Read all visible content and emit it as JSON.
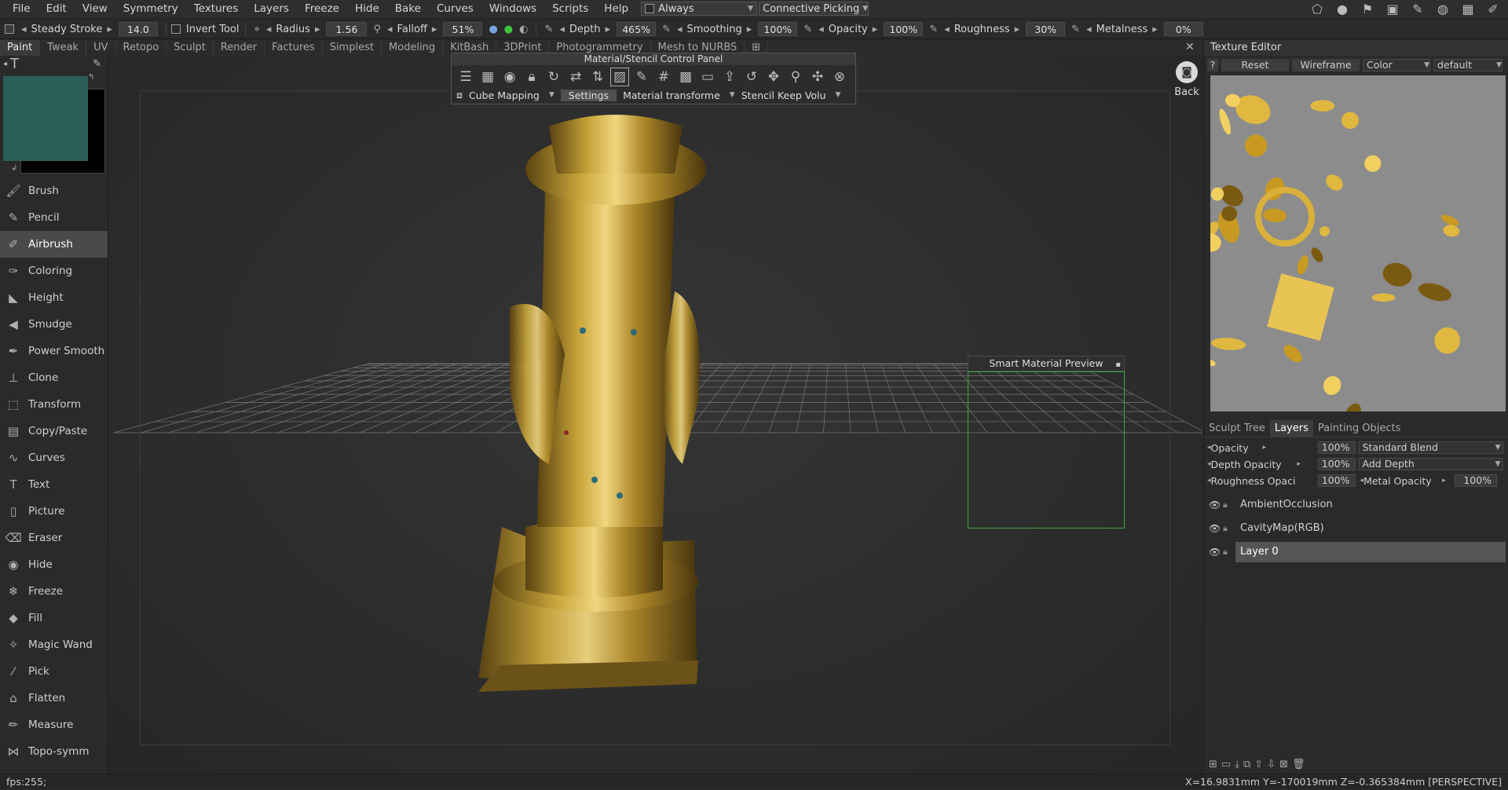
{
  "menu": [
    "File",
    "Edit",
    "View",
    "Symmetry",
    "Textures",
    "Layers",
    "Freeze",
    "Hide",
    "Bake",
    "Curves",
    "Windows",
    "Scripts",
    "Help"
  ],
  "menu_extra": {
    "always_label": "Always",
    "picking_label": "Connective  Picking"
  },
  "toolbar": {
    "steady_stroke_label": "Steady  Stroke",
    "steady_stroke_value": "14.0",
    "invert_tool_label": "Invert  Tool",
    "radius_label": "Radius",
    "radius_value": "1.56",
    "falloff_label": "Falloff",
    "falloff_value": "51%",
    "depth_label": "Depth",
    "depth_value": "465%",
    "smoothing_label": "Smoothing",
    "smoothing_value": "100%",
    "opacity_label": "Opacity",
    "opacity_value": "100%",
    "roughness_label": "Roughness",
    "roughness_value": "30%",
    "metalness_label": "Metalness",
    "metalness_value": "0%"
  },
  "room_tabs": [
    "Paint",
    "Tweak",
    "UV",
    "Retopo",
    "Sculpt",
    "Render",
    "Factures",
    "Simplest",
    "Modeling",
    "KitBash",
    "3DPrint",
    "Photogrammetry",
    "Mesh  to  NURBS"
  ],
  "colors": {
    "primary_color": "#2c5e58",
    "secondary_color": "#000000",
    "accent_green": "#3ea83e"
  },
  "tools": [
    "Brush",
    "Pencil",
    "Airbrush",
    "Coloring",
    "Height",
    "Smudge",
    "Power  Smooth",
    "Clone",
    "Transform",
    "Copy/Paste",
    "Curves",
    "Text",
    "Picture",
    "Eraser",
    "Hide",
    "Freeze",
    "Fill",
    "Magic  Wand",
    "Pick",
    "Flatten",
    "Measure",
    "Topo-symm"
  ],
  "tool_icons": [
    "brush-icon",
    "pencil-icon",
    "airbrush-icon",
    "coloring-icon",
    "height-icon",
    "smudge-icon",
    "power-smooth-icon",
    "clone-icon",
    "transform-icon",
    "copy-paste-icon",
    "curves-icon",
    "text-icon",
    "picture-icon",
    "eraser-icon",
    "hide-icon",
    "freeze-icon",
    "fill-icon",
    "magic-wand-icon",
    "pick-icon",
    "flatten-icon",
    "measure-icon",
    "topo-symm-icon"
  ],
  "active_tool": "Airbrush",
  "stencil_panel": {
    "title": "Material/Stencil  Control  Panel",
    "cube_mapping": "Cube  Mapping",
    "settings": "Settings",
    "material_transform": "Material  transforme",
    "stencil_keep": "Stencil  Keep  Volu"
  },
  "back_label": "Back",
  "smart_preview_title": "Smart  Material  Preview",
  "texture_editor": {
    "title": "Texture  Editor",
    "reset": "Reset",
    "wireframe": "Wireframe",
    "channel": "Color",
    "preset": "default"
  },
  "panel_tabs": [
    "Sculpt  Tree",
    "Layers",
    "Painting  Objects"
  ],
  "active_panel_tab": "Layers",
  "layer_props": {
    "opacity_label": "Opacity",
    "opacity_value": "100%",
    "blend": "Standard  Blend",
    "depth_opacity_label": "Depth  Opacity",
    "depth_opacity_value": "100%",
    "depth_mode": "Add  Depth",
    "roughness_opacity_label": "Roughness  Opaci",
    "roughness_opacity_value": "100%",
    "metal_opacity_label": "Metal  Opacity",
    "metal_opacity_value": "100%"
  },
  "layers": [
    "AmbientOcclusion",
    "CavityMap(RGB)",
    "Layer  0"
  ],
  "selected_layer": "Layer  0",
  "status": {
    "fps": "fps:255;",
    "coords": "X=16.9831mm   Y=-170019mm   Z=-0.365384mm   [PERSPECTIVE]"
  }
}
